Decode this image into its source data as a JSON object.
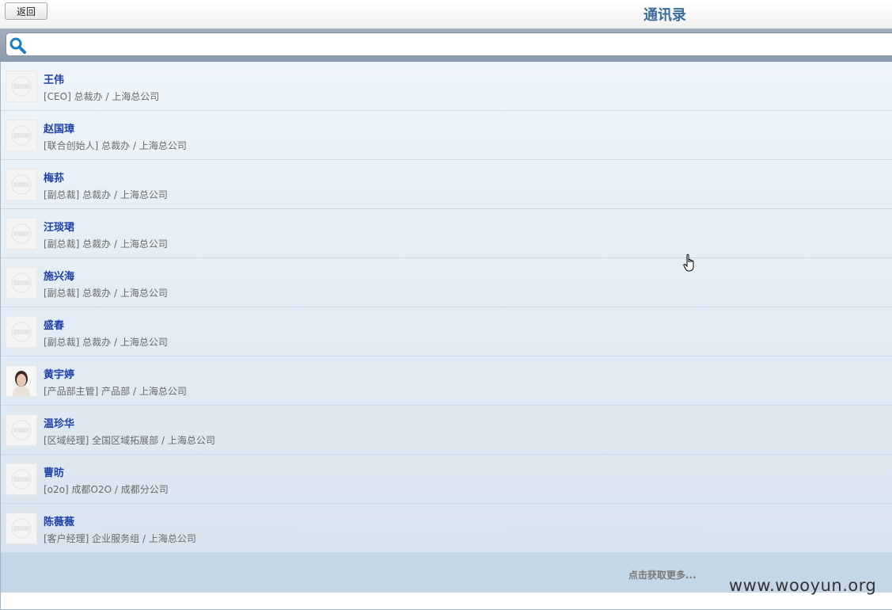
{
  "header": {
    "back_label": "返回",
    "title": "通讯录"
  },
  "search": {
    "value": "",
    "placeholder": "",
    "icon": "search-icon"
  },
  "contacts": [
    {
      "name": "王伟",
      "meta": "[CEO] 总裁办 / 上海总公司",
      "avatar": "placeholder"
    },
    {
      "name": "赵国璋",
      "meta": "[联合创始人] 总裁办 / 上海总公司",
      "avatar": "placeholder"
    },
    {
      "name": "梅荪",
      "meta": "[副总裁] 总裁办 / 上海总公司",
      "avatar": "placeholder"
    },
    {
      "name": "汪琰珺",
      "meta": "[副总裁] 总裁办 / 上海总公司",
      "avatar": "placeholder"
    },
    {
      "name": "施兴海",
      "meta": "[副总裁] 总裁办 / 上海总公司",
      "avatar": "placeholder"
    },
    {
      "name": "盛春",
      "meta": "[副总裁] 总裁办 / 上海总公司",
      "avatar": "placeholder"
    },
    {
      "name": "黄宇婷",
      "meta": "[产品部主管] 产品部 / 上海总公司",
      "avatar": "photo"
    },
    {
      "name": "温珍华",
      "meta": "[区域经理] 全国区域拓展部 / 上海总公司",
      "avatar": "placeholder"
    },
    {
      "name": "曹昉",
      "meta": "[o2o] 成都O2O / 成都分公司",
      "avatar": "placeholder"
    },
    {
      "name": "陈薇薇",
      "meta": "[客户经理] 企业服务组 / 上海总公司",
      "avatar": "placeholder"
    }
  ],
  "load_more_label": "点击获取更多...",
  "watermark": "www.wooyun.org",
  "colors": {
    "title": "#3c6d9c",
    "name": "#1e3fa8",
    "meta": "#6a6a6a",
    "list_bg_top": "#eef5fa",
    "list_bg_bottom": "#d8e4ee",
    "more_bg": "#c5d7e6"
  }
}
